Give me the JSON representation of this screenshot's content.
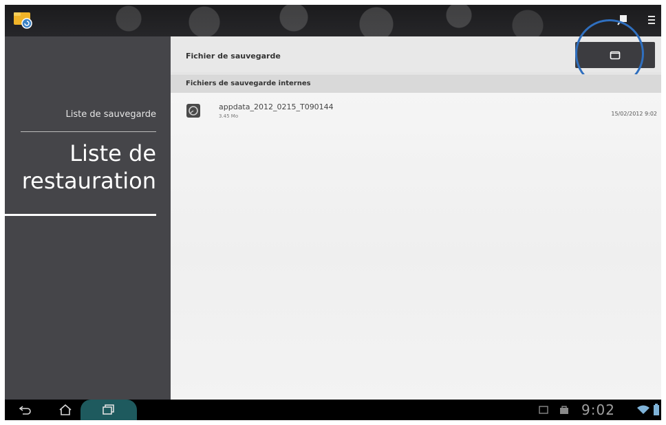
{
  "sidebar": {
    "backup_list": "Liste de sauvegarde",
    "restore_list_line1": "Liste de",
    "restore_list_line2": "restauration"
  },
  "main": {
    "header_title": "Fichier de sauvegarde",
    "section_title": "Fichiers de sauvegarde internes",
    "files": [
      {
        "name": "appdata_2012_0215_T090144",
        "size": "3.45 Mo",
        "date": "15/02/2012 9:02"
      }
    ]
  },
  "status_bar": {
    "time": "9:02"
  },
  "icons": {
    "app": "app-backup-icon",
    "folder": "folder-icon",
    "back": "back-icon",
    "home": "home-icon",
    "recent": "recent-apps-icon",
    "wifi": "wifi-icon",
    "battery": "battery-icon"
  },
  "colors": {
    "sidebar": "#454549",
    "highlight": "#2f6fbf",
    "recent_pill": "#1e5a5e"
  }
}
